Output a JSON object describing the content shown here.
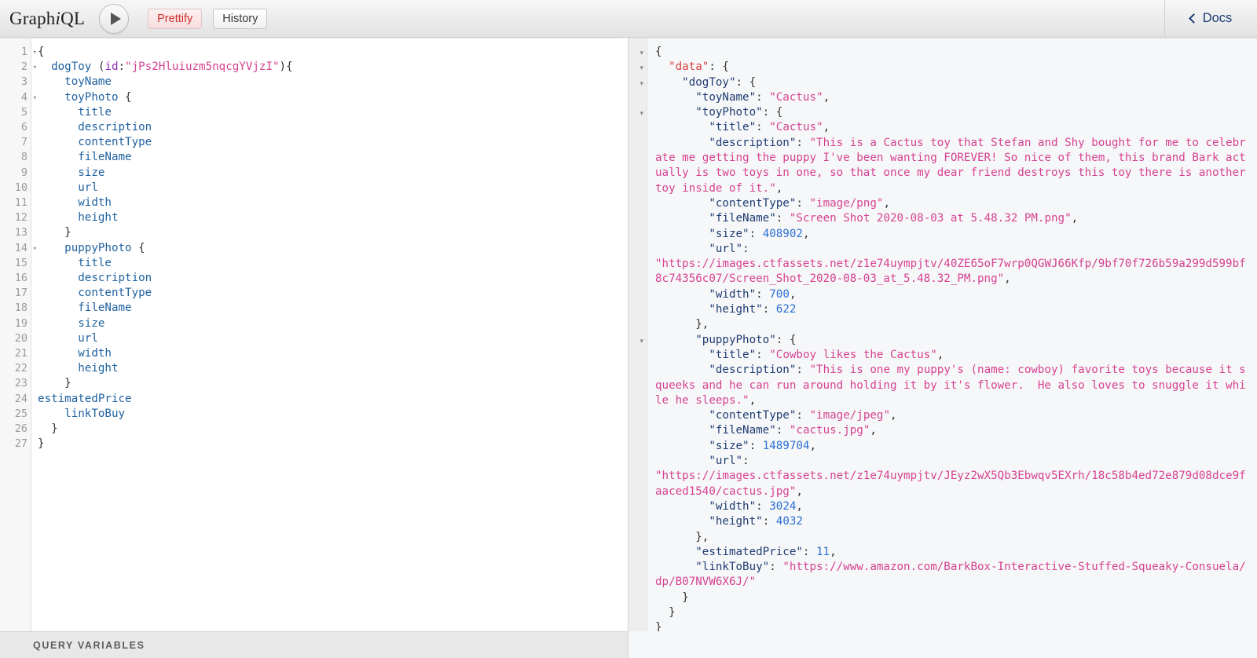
{
  "app": {
    "title_graph": "Graph",
    "title_i": "i",
    "title_ql": "QL"
  },
  "toolbar": {
    "execute_label": "▶",
    "prettify_label": "Prettify",
    "history_label": "History",
    "docs_label": "Docs",
    "docs_chevron": "chevron-left-icon"
  },
  "query_editor": {
    "line_numbers": [
      "1",
      "2",
      "3",
      "4",
      "5",
      "6",
      "7",
      "8",
      "9",
      "10",
      "11",
      "12",
      "13",
      "14",
      "15",
      "16",
      "17",
      "18",
      "19",
      "20",
      "21",
      "22",
      "23",
      "24",
      "25",
      "26",
      "27"
    ],
    "fold_lines": [
      "1",
      "2",
      "4",
      "14"
    ],
    "lines": [
      {
        "n": 1,
        "text": "{"
      },
      {
        "n": 2,
        "text": "  dogToy (id:\"jPs2Hluiuzm5nqcgYVjzI\"){"
      },
      {
        "n": 3,
        "text": "    toyName"
      },
      {
        "n": 4,
        "text": "    toyPhoto {"
      },
      {
        "n": 5,
        "text": "      title"
      },
      {
        "n": 6,
        "text": "      description"
      },
      {
        "n": 7,
        "text": "      contentType"
      },
      {
        "n": 8,
        "text": "      fileName"
      },
      {
        "n": 9,
        "text": "      size"
      },
      {
        "n": 10,
        "text": "      url"
      },
      {
        "n": 11,
        "text": "      width"
      },
      {
        "n": 12,
        "text": "      height"
      },
      {
        "n": 13,
        "text": "    }"
      },
      {
        "n": 14,
        "text": "    puppyPhoto {"
      },
      {
        "n": 15,
        "text": "      title"
      },
      {
        "n": 16,
        "text": "      description"
      },
      {
        "n": 17,
        "text": "      contentType"
      },
      {
        "n": 18,
        "text": "      fileName"
      },
      {
        "n": 19,
        "text": "      size"
      },
      {
        "n": 20,
        "text": "      url"
      },
      {
        "n": 21,
        "text": "      width"
      },
      {
        "n": 22,
        "text": "      height"
      },
      {
        "n": 23,
        "text": "    }"
      },
      {
        "n": 24,
        "text": "estimatedPrice"
      },
      {
        "n": 25,
        "text": "    linkToBuy"
      },
      {
        "n": 26,
        "text": "  }"
      },
      {
        "n": 27,
        "text": "}"
      }
    ],
    "query_text": "{\n  dogToy (id:\"jPs2Hluiuzm5nqcgYVjzI\"){\n    toyName\n    toyPhoto {\n      title\n      description\n      contentType\n      fileName\n      size\n      url\n      width\n      height\n    }\n    puppyPhoto {\n      title\n      description\n      contentType\n      fileName\n      size\n      url\n      width\n      height\n    }\nestimatedPrice\n    linkToBuy\n  }\n}",
    "argument_name": "id",
    "argument_value": "jPs2Hluiuzm5nqcgYVjzI",
    "root_field": "dogToy"
  },
  "result": {
    "root_key": "data",
    "object_key": "dogToy",
    "toyName": "Cactus",
    "toyPhoto": {
      "title": "Cactus",
      "description": "This is a Cactus toy that Stefan and Shy bought for me to celebrate me getting the puppy I've been wanting FOREVER! So nice of them, this brand Bark actually is two toys in one, so that once my dear friend destroys this toy there is another toy inside of it.",
      "contentType": "image/png",
      "fileName": "Screen Shot 2020-08-03 at 5.48.32 PM.png",
      "size": "408902",
      "url": "https://images.ctfassets.net/z1e74uympjtv/40ZE65oF7wrp0QGWJ66Kfp/9bf70f726b59a299d599bf8c74356c07/Screen_Shot_2020-08-03_at_5.48.32_PM.png",
      "width": "700",
      "height": "622"
    },
    "puppyPhoto": {
      "title": "Cowboy likes the Cactus",
      "description": "This is one my puppy's (name: cowboy) favorite toys because it squeeks and he can run around holding it by it's flower.  He also loves to snuggle it while he sleeps.",
      "contentType": "image/jpeg",
      "fileName": "cactus.jpg",
      "size": "1489704",
      "url": "https://images.ctfassets.net/z1e74uympjtv/JEyz2wX5Qb3Ebwqv5EXrh/18c58b4ed72e879d08dce9faaced1540/cactus.jpg",
      "width": "3024",
      "height": "4032"
    },
    "estimatedPrice": "11",
    "linkToBuy": "https://www.amazon.com/BarkBox-Interactive-Stuffed-Squeaky-Consuela/dp/B07NVW6X6J/"
  },
  "bottom": {
    "query_variables_label": "QUERY VARIABLES"
  },
  "colors": {
    "string": "#d64292",
    "number": "#2a6fd6",
    "key": "#1f3c73",
    "root_key": "#d64242",
    "field": "#1f61a0",
    "argument": "#8b2bb9",
    "prettify": "#d32f2f",
    "docs": "#1f3c73"
  }
}
